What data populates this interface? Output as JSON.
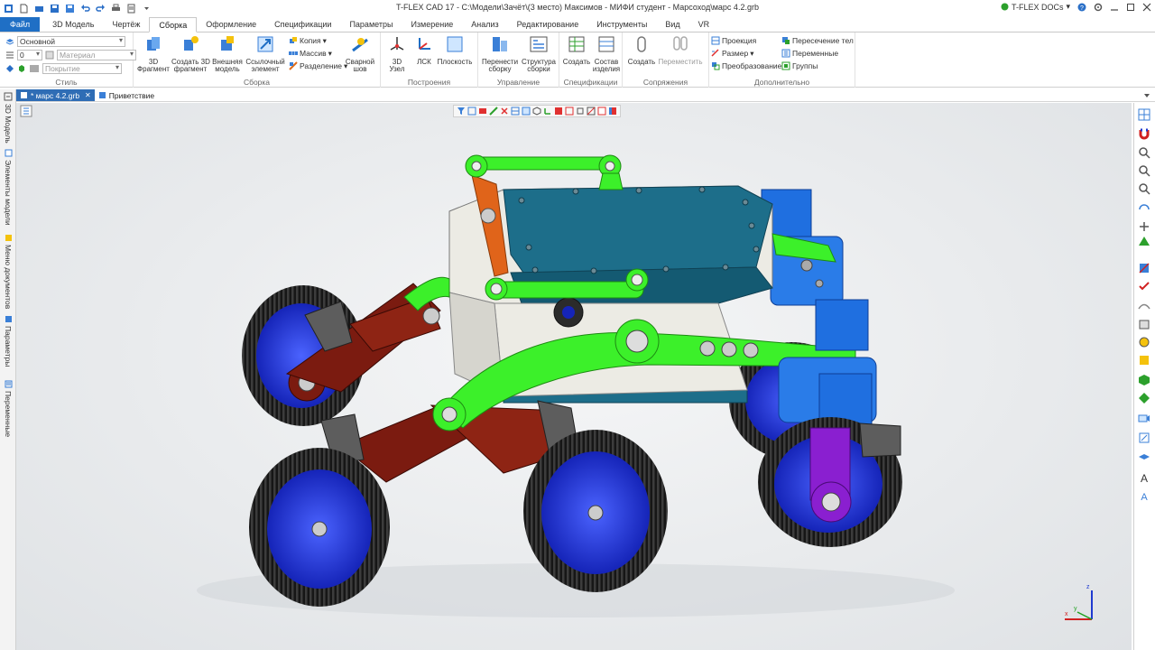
{
  "title": "T-FLEX CAD 17 - C:\\Модели\\Зачёт\\(3 место) Максимов - МИФИ студент - Марсоход\\марс 4.2.grb",
  "docs_button": "T-FLEX DOCs",
  "tabs": [
    "Файл",
    "3D Модель",
    "Чертёж",
    "Сборка",
    "Оформление",
    "Спецификации",
    "Параметры",
    "Измерение",
    "Анализ",
    "Редактирование",
    "Инструменты",
    "Вид",
    "VR"
  ],
  "style": {
    "layer": "Основной",
    "level": "0",
    "material": "Материал",
    "coating": "Покрытие",
    "label": "Стиль"
  },
  "ribbon": {
    "assembly": {
      "label": "Сборка",
      "fragment3d": "3D\nФрагмент",
      "create_fragment": "Создать 3D\nфрагмент",
      "external_model": "Внешняя\nмодель",
      "reference_element": "Ссылочный\nэлемент",
      "copy": "Копия",
      "array": "Массив",
      "split": "Разделение",
      "weld": "Сварной\nшов"
    },
    "build": {
      "label": "Построения",
      "node3d": "3D\nУзел",
      "lcs": "ЛСК",
      "plane": "Плоскость"
    },
    "manage": {
      "label": "Управление",
      "rebuild": "Перенести\nсборку",
      "structure": "Структура\nсборки"
    },
    "spec": {
      "label": "Спецификации",
      "create": "Создать",
      "composition": "Состав\nизделия"
    },
    "mates": {
      "label": "Сопряжения",
      "create": "Создать",
      "move": "Переместить"
    },
    "extra": {
      "label": "Дополнительно",
      "projection": "Проекция",
      "size": "Размер",
      "transform": "Преобразование",
      "intersection": "Пересечение тел",
      "variables": "Переменные",
      "groups": "Группы"
    }
  },
  "doc_tabs": [
    {
      "label": "* марс 4.2.grb",
      "active": true
    },
    {
      "label": "Приветствие",
      "active": false
    }
  ],
  "left_panel": [
    "3D Модель",
    "Элементы модели",
    "Меню документов",
    "Параметры",
    "Переменные"
  ],
  "axes": {
    "x": "x",
    "y": "y",
    "z": "z"
  },
  "colors": {
    "accent": "#1f6fc5",
    "body_teal": "#1d6e8a",
    "chassis_green": "#3cf02a",
    "arm_red": "#7b1b10",
    "wheel_blue": "#1a2fd6",
    "tire_black": "#1e1e1e",
    "motor_blue": "#1f6fe0",
    "purple": "#8a1fd0",
    "orange": "#e0641a"
  }
}
